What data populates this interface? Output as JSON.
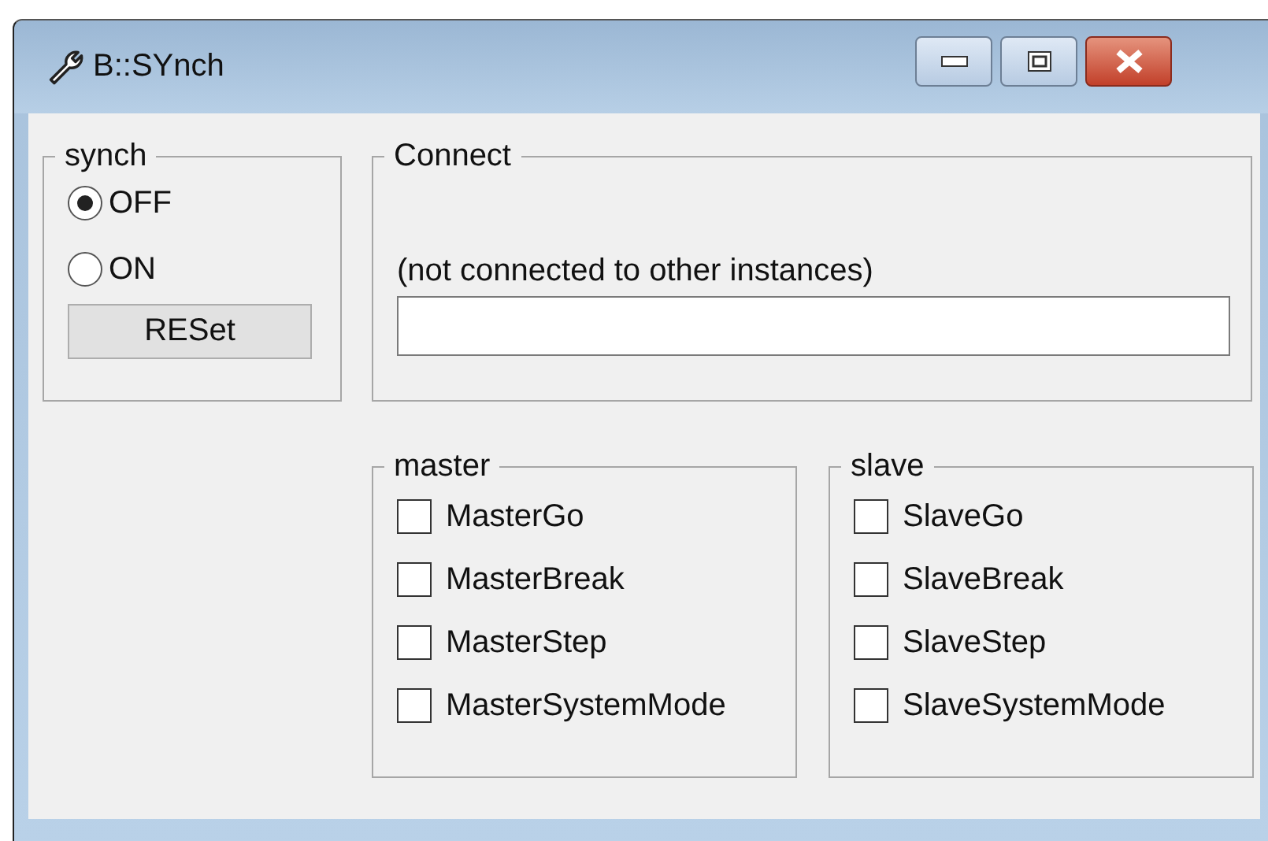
{
  "window": {
    "title": "B::SYnch"
  },
  "synch": {
    "label": "synch",
    "options": [
      {
        "label": "OFF",
        "selected": true
      },
      {
        "label": "ON",
        "selected": false
      }
    ],
    "reset_button": "RESet"
  },
  "connect": {
    "label": "Connect",
    "status": "(not connected to other instances)"
  },
  "groups": [
    {
      "label": "master",
      "options": [
        {
          "label": "MasterGo",
          "checked": false
        },
        {
          "label": "MasterBreak",
          "checked": false
        },
        {
          "label": "MasterStep",
          "checked": false
        },
        {
          "label": "MasterSystemMode",
          "checked": false
        }
      ]
    },
    {
      "label": "slave",
      "options": [
        {
          "label": "SlaveGo",
          "checked": false
        },
        {
          "label": "SlaveBreak",
          "checked": false
        },
        {
          "label": "SlaveStep",
          "checked": false
        },
        {
          "label": "SlaveSystemMode",
          "checked": false
        }
      ]
    }
  ]
}
